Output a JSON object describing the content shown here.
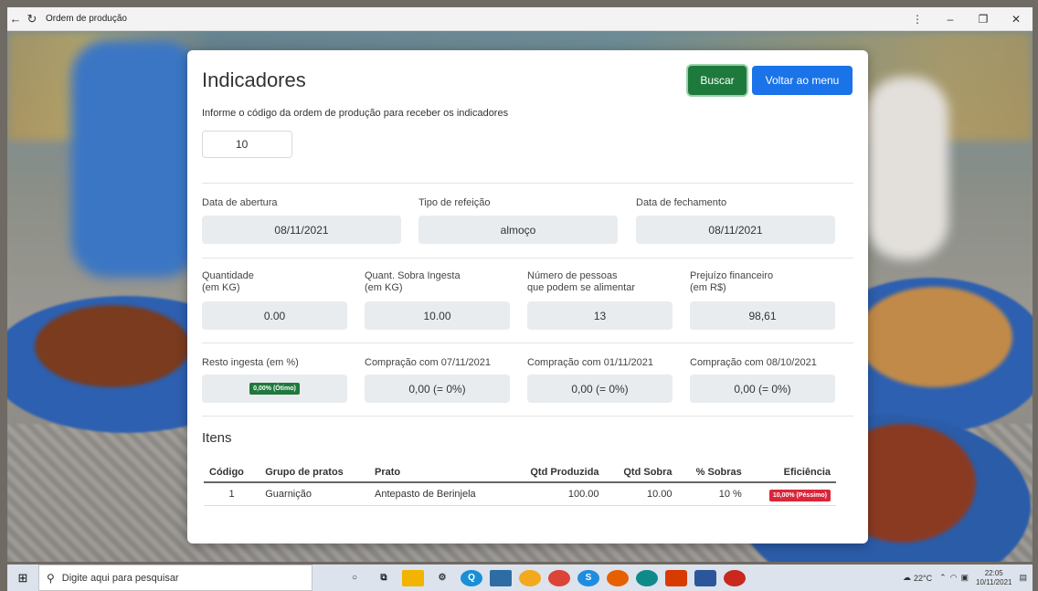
{
  "window": {
    "title": "Ordem de produção"
  },
  "page": {
    "title": "Indicadores",
    "instruction": "Informe o código da ordem de produção para receber os indicadores",
    "code_value": "10",
    "buttons": {
      "search": "Buscar",
      "back": "Voltar ao menu"
    }
  },
  "info": {
    "abertura": {
      "label": "Data de abertura",
      "value": "08/11/2021"
    },
    "refeicao": {
      "label": "Tipo de refeição",
      "value": "almoço"
    },
    "fechamento": {
      "label": "Data de fechamento",
      "value": "08/11/2021"
    }
  },
  "metrics": {
    "quantidade": {
      "label1": "Quantidade",
      "label2": "(em KG)",
      "value": "0.00"
    },
    "sobra": {
      "label1": "Quant. Sobra Ingesta",
      "label2": "(em KG)",
      "value": "10.00"
    },
    "pessoas": {
      "label1": "Número de pessoas",
      "label2": "que podem se alimentar",
      "value": "13"
    },
    "prejuizo": {
      "label1": "Prejuízo financeiro",
      "label2": "(em R$)",
      "value": "98,61"
    }
  },
  "comparisons": {
    "resto": {
      "label": "Resto ingesta (em %)",
      "badge": "0,00% (Ótimo)"
    },
    "c1": {
      "label": "Compração com 07/11/2021",
      "value": "0,00 (= 0%)"
    },
    "c2": {
      "label": "Compração com 01/11/2021",
      "value": "0,00 (= 0%)"
    },
    "c3": {
      "label": "Compração com 08/10/2021",
      "value": "0,00 (= 0%)"
    }
  },
  "items": {
    "title": "Itens",
    "columns": [
      "Código",
      "Grupo de pratos",
      "Prato",
      "Qtd Produzida",
      "Qtd Sobra",
      "% Sobras",
      "Eficiência"
    ],
    "rows": [
      {
        "codigo": "1",
        "grupo": "Guarnição",
        "prato": "Antepasto de Berinjela",
        "produzida": "100.00",
        "sobra": "10.00",
        "pct": "10 %",
        "eficiencia": "10,00% (Péssimo)"
      }
    ]
  },
  "taskbar": {
    "search_placeholder": "Digite aqui para pesquisar",
    "weather": "22°C",
    "time": "22:05",
    "date": "10/11/2021"
  },
  "colors": {
    "success": "#1e7a3c",
    "primary": "#1a73e8",
    "danger": "#d9263b"
  }
}
